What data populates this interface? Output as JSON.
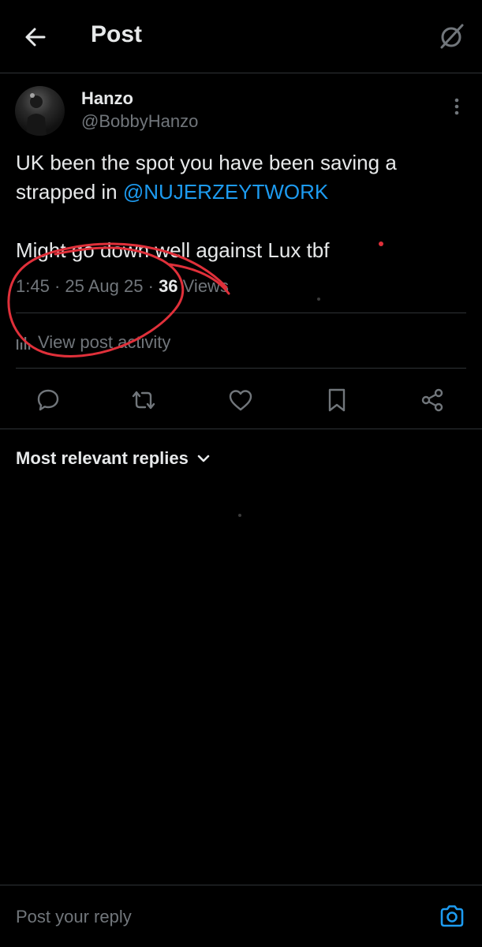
{
  "header": {
    "title": "Post",
    "back_icon": "arrow-left-icon",
    "grok_icon": "grok-slash-icon"
  },
  "post": {
    "author": {
      "name": "Hanzo",
      "handle": "@BobbyHanzo"
    },
    "text": {
      "line1": "UK been the spot you have been saving  a",
      "line2_prefix": "strapped in ",
      "mention": "@NUJERZEYTWORK",
      "line3": "Might go down well against Lux tbf"
    },
    "meta": {
      "time": "1:45",
      "separator": " · ",
      "date": "25 Aug 25",
      "views_count": "36",
      "views_label": " Views"
    },
    "activity_label": "View post activity"
  },
  "actions": [
    {
      "name": "reply",
      "icon": "reply-bubble-icon"
    },
    {
      "name": "repost",
      "icon": "repost-icon"
    },
    {
      "name": "like",
      "icon": "heart-icon"
    },
    {
      "name": "bookmark",
      "icon": "bookmark-icon"
    },
    {
      "name": "share",
      "icon": "share-icon"
    }
  ],
  "replies": {
    "sort_label": "Most relevant replies"
  },
  "reply_bar": {
    "placeholder": "Post your reply"
  },
  "colors": {
    "background": "#000000",
    "text": "#e7e9ea",
    "muted": "#71767b",
    "accent": "#1d9bf0",
    "divider": "#2f3336",
    "annotation": "#e0303a"
  }
}
